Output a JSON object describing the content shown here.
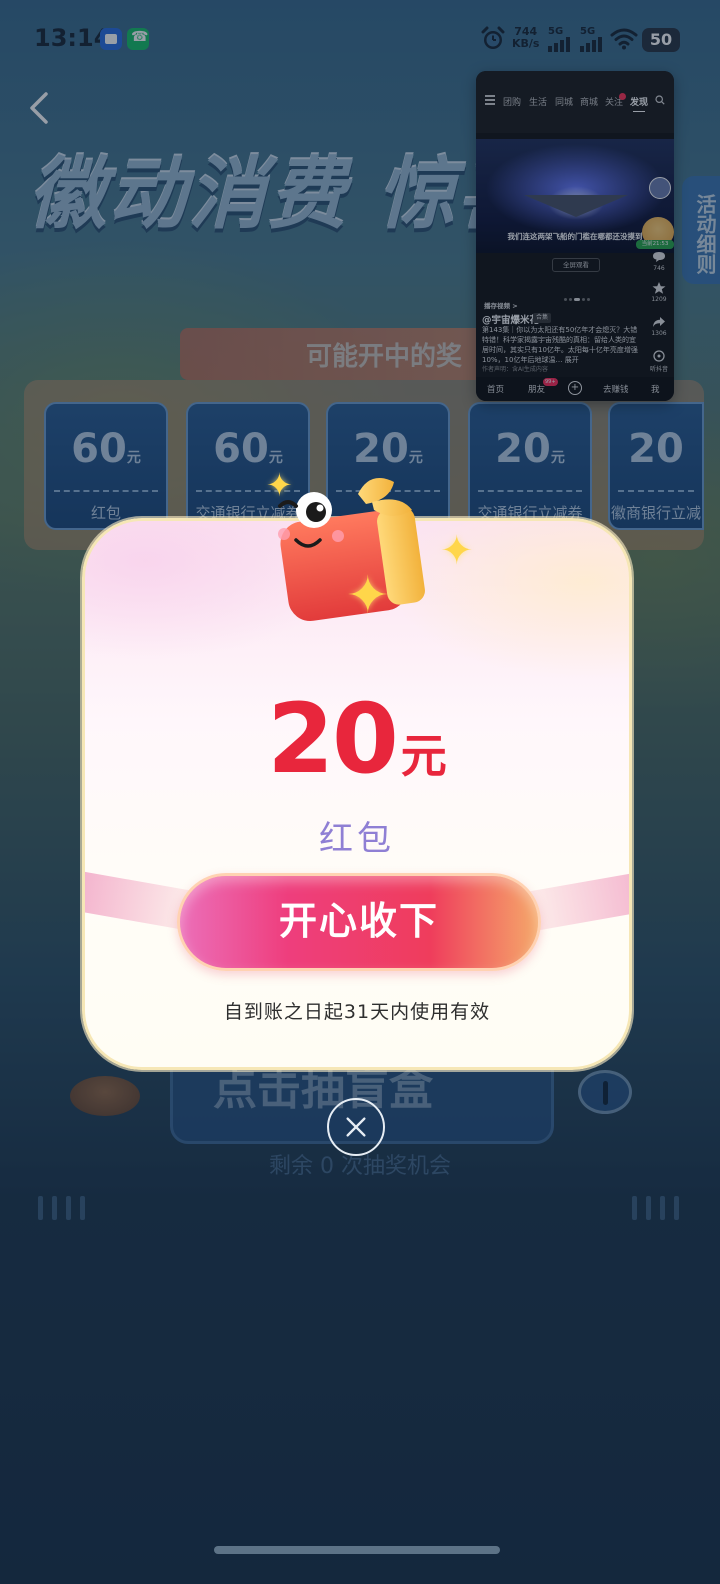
{
  "status_bar": {
    "time": "13:14",
    "net_speed_value": "744",
    "net_speed_unit": "KB/s",
    "sim1_label": "5G",
    "sim2_label": "5G",
    "battery_level": "50",
    "icons": [
      "video-app-icon",
      "phone-app-icon",
      "alarm-icon",
      "signal-icon",
      "wifi-icon",
      "battery-icon"
    ]
  },
  "page": {
    "banner_title": "徽动消费 惊喜",
    "possible_prizes_label": "可能开中的奖",
    "rules_tab_label": "活动细则",
    "prizes": [
      {
        "amount": "60",
        "unit": "元",
        "name": "红包"
      },
      {
        "amount": "60",
        "unit": "元",
        "name": "交通银行立减券"
      },
      {
        "amount": "20",
        "unit": "元",
        "name": ""
      },
      {
        "amount": "20",
        "unit": "元",
        "name": "交通银行立减券"
      },
      {
        "amount": "20",
        "unit": "",
        "name": "徽商银行立减"
      }
    ],
    "draw_button_label": "点击抽盲盒",
    "remaining_text": "剩余 0 次抽奖机会"
  },
  "pip": {
    "top_tabs": [
      "团购",
      "生活",
      "同城",
      "商城",
      "关注",
      "发现"
    ],
    "active_tab": "发现",
    "notification_count": "8",
    "video_caption": "我们连这两架飞船的门槛在哪都还没摸到",
    "fullscreen_label": "全屏观看",
    "side_counts": {
      "comments": "746",
      "favorites": "1209",
      "shares": "1306",
      "listen": "听抖音"
    },
    "bear_badge": "当前21:53",
    "collection_label": "播存视频 >",
    "author": "@宇宙爆米花",
    "author_tag": "合集",
    "description": "第143集｜你以为太阳还有50亿年才会熄灭？大错特错！科学家揭露宇宙残酷的真相：留给人类的宜居时间，其实只有10亿年。太阳每十亿年亮度增强10%，10亿年后地球温… 展开",
    "note": "作者声明：含AI生成内容",
    "bottom_nav": [
      "首页",
      "朋友",
      "+",
      "去赚钱",
      "我"
    ],
    "friends_badge": "99+"
  },
  "modal": {
    "amount": "20",
    "unit": "元",
    "prize_name": "红包",
    "claim_button_label": "开心收下",
    "validity_text": "自到账之日起31天内使用有效"
  },
  "colors": {
    "amount_red": "#e8263c",
    "prize_name_purple": "#8f7fd4",
    "button_pink": "#ee3e7d",
    "star_yellow": "#ffd64a"
  }
}
